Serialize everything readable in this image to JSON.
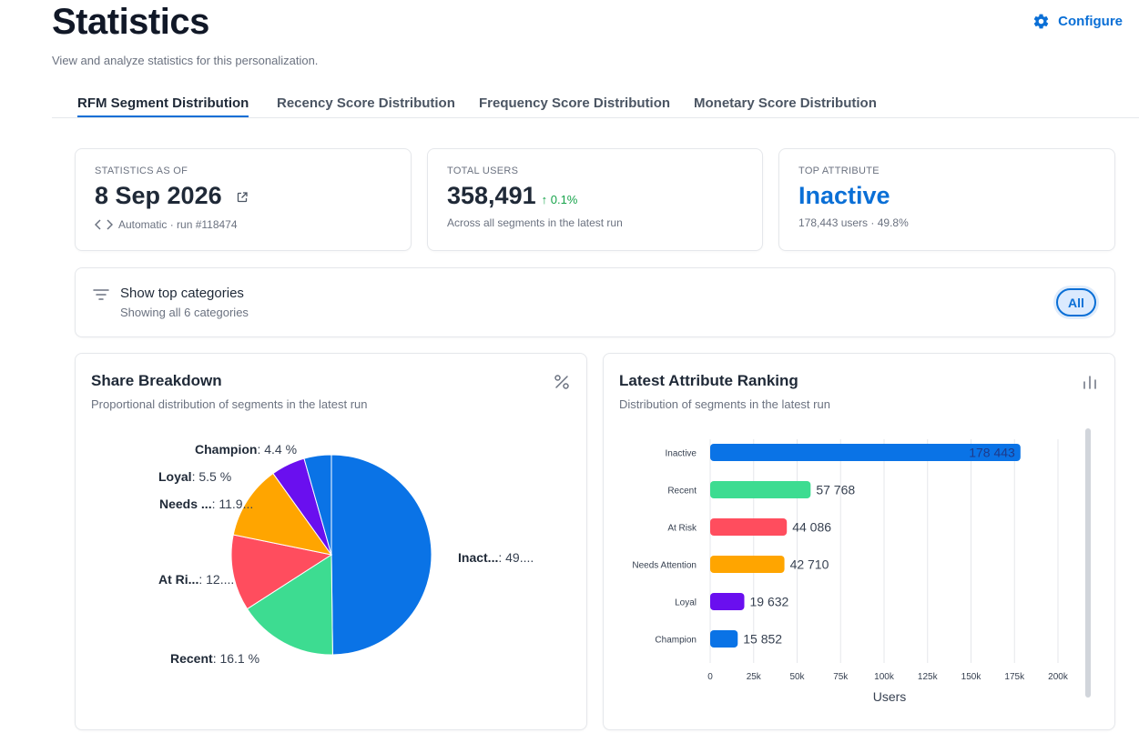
{
  "header": {
    "title": "Statistics",
    "subtitle": "View and analyze statistics for this personalization.",
    "configure_label": "Configure"
  },
  "tabs": [
    {
      "label": "RFM Segment Distribution",
      "active": true
    },
    {
      "label": "Recency Score Distribution",
      "active": false
    },
    {
      "label": "Frequency Score Distribution",
      "active": false
    },
    {
      "label": "Monetary Score Distribution",
      "active": false
    }
  ],
  "stats": {
    "as_of": {
      "label": "STATISTICS AS OF",
      "value": "8 Sep 2026",
      "sub": "Automatic · run #118474"
    },
    "total_users": {
      "label": "TOTAL USERS",
      "value": "358,491",
      "trend": "↑ 0.1%",
      "sub": "Across all segments in the latest run"
    },
    "top_attribute": {
      "label": "TOP ATTRIBUTE",
      "value": "Inactive",
      "sub": "178,443 users · 49.8%"
    }
  },
  "filter": {
    "title": "Show top categories",
    "subtitle": "Showing all 6 categories",
    "all_label": "All"
  },
  "share_panel": {
    "title": "Share Breakdown",
    "subtitle": "Proportional distribution of segments in the latest run",
    "icon": "percent-icon"
  },
  "ranking_panel": {
    "title": "Latest Attribute Ranking",
    "subtitle": "Distribution of segments in the latest run",
    "icon": "bar-chart-icon"
  },
  "colors": {
    "accent": "#0a6fd6",
    "inactive": "#0a73e6",
    "recent": "#3ddc91",
    "at_risk": "#ff4d5e",
    "needs_attention": "#ffa500",
    "loyal": "#6a0fef",
    "champion": "#0a73e6"
  },
  "chart_data": [
    {
      "type": "pie",
      "slices": [
        {
          "name": "Inactive",
          "value": 49.8,
          "label": "Inact...",
          "pct_text": ": 49....",
          "color": "#0a73e6"
        },
        {
          "name": "Recent",
          "value": 16.1,
          "label": "Recent",
          "pct_text": ": 16.1 %",
          "color": "#3ddc91"
        },
        {
          "name": "At Risk",
          "value": 12.3,
          "label": "At Ri...",
          "pct_text": ": 12....",
          "color": "#ff4d5e"
        },
        {
          "name": "Needs Attention",
          "value": 11.9,
          "label": "Needs ...",
          "pct_text": ": 11.9...",
          "color": "#ffa500"
        },
        {
          "name": "Loyal",
          "value": 5.5,
          "label": "Loyal",
          "pct_text": ": 5.5 %",
          "color": "#6a0fef"
        },
        {
          "name": "Champion",
          "value": 4.4,
          "label": "Champion",
          "pct_text": ": 4.4 %",
          "color": "#0a73e6"
        }
      ]
    },
    {
      "type": "bar",
      "orientation": "horizontal",
      "categories": [
        "Inactive",
        "Recent",
        "At Risk",
        "Needs Attention",
        "Loyal",
        "Champion"
      ],
      "values": [
        178443,
        57768,
        44086,
        42710,
        19632,
        15852
      ],
      "value_labels": [
        "178 443",
        "57 768",
        "44 086",
        "42 710",
        "19 632",
        "15 852"
      ],
      "colors": [
        "#0a73e6",
        "#3ddc91",
        "#ff4d5e",
        "#ffa500",
        "#6a0fef",
        "#0a73e6"
      ],
      "xlabel": "Users",
      "xlim": [
        0,
        200000
      ],
      "xticks": [
        0,
        25000,
        50000,
        75000,
        100000,
        125000,
        150000,
        175000,
        200000
      ],
      "xtick_labels": [
        "0",
        "25k",
        "50k",
        "75k",
        "100k",
        "125k",
        "150k",
        "175k",
        "200k"
      ],
      "grid": true
    }
  ]
}
